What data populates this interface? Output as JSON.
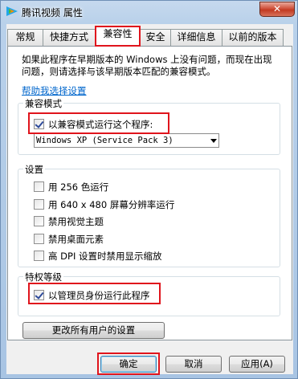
{
  "window": {
    "title": "腾讯视频 属性",
    "close_label": "✕"
  },
  "tabs": [
    "常规",
    "快捷方式",
    "兼容性",
    "安全",
    "详细信息",
    "以前的版本"
  ],
  "compat": {
    "description": "如果此程序在早期版本的 Windows 上没有问题，而现在出现问题，则请选择与该早期版本匹配的兼容模式。",
    "help_link": "帮助我选择设置",
    "mode_group": {
      "title": "兼容模式",
      "checkbox_label": "以兼容模式运行这个程序:",
      "checked": true,
      "selected_os": "Windows XP (Service Pack 3)"
    },
    "settings_group": {
      "title": "设置",
      "items": [
        {
          "label": "用 256 色运行",
          "checked": false
        },
        {
          "label": "用 640 x 480 屏幕分辨率运行",
          "checked": false
        },
        {
          "label": "禁用视觉主题",
          "checked": false
        },
        {
          "label": "禁用桌面元素",
          "checked": false
        },
        {
          "label": "高 DPI 设置时禁用显示缩放",
          "checked": false
        }
      ]
    },
    "privilege_group": {
      "title": "特权等级",
      "checkbox_label": "以管理员身份运行此程序",
      "checked": true
    },
    "all_users_button": "更改所有用户的设置"
  },
  "footer": {
    "ok": "确定",
    "cancel": "取消",
    "apply": "应用(A)"
  },
  "colors": {
    "highlight": "#e0141c",
    "link": "#0066cc"
  }
}
